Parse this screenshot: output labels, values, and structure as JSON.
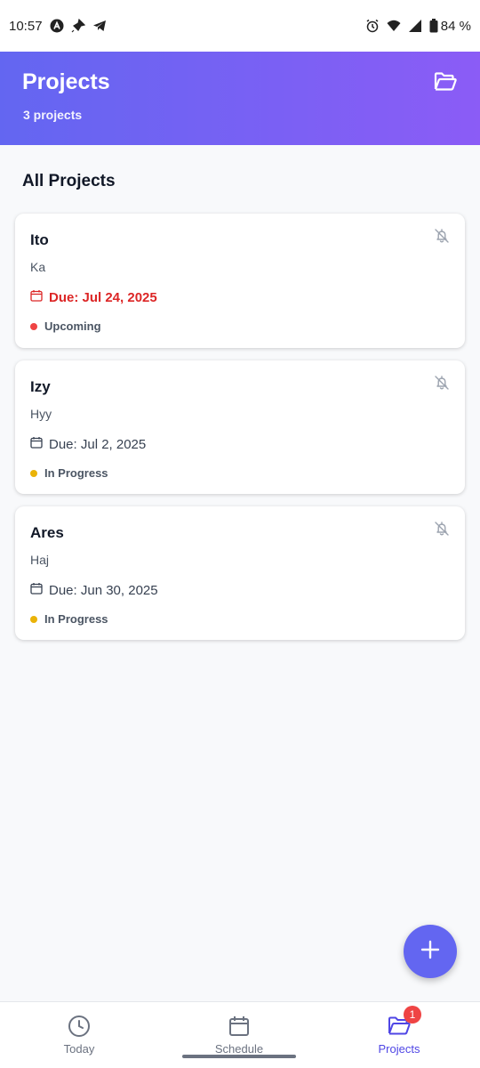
{
  "status_bar": {
    "time": "10:57",
    "battery": "84 %"
  },
  "header": {
    "title": "Projects",
    "subtitle": "3 projects",
    "folder_icon": "folder-open-icon"
  },
  "section": {
    "title": "All Projects"
  },
  "projects": [
    {
      "name": "Ito",
      "description": "Ka",
      "due": "Due: Jul 24, 2025",
      "status": "Upcoming",
      "status_color": "#ef4444",
      "overdue": true
    },
    {
      "name": "Izy",
      "description": "Hyy",
      "due": "Due: Jul 2, 2025",
      "status": "In Progress",
      "status_color": "#eab308",
      "overdue": false
    },
    {
      "name": "Ares",
      "description": "Haj",
      "due": "Due: Jun 30, 2025",
      "status": "In Progress",
      "status_color": "#eab308",
      "overdue": false
    }
  ],
  "fab": {
    "icon": "plus-icon"
  },
  "bottom_nav": {
    "items": [
      {
        "label": "Today",
        "icon": "clock-icon"
      },
      {
        "label": "Schedule",
        "icon": "calendar-icon"
      },
      {
        "label": "Projects",
        "icon": "folder-icon",
        "badge": "1"
      }
    ]
  },
  "colors": {
    "accent": "#6366f1",
    "header_gradient_end": "#8b5cf6",
    "overdue": "#dc2626"
  }
}
